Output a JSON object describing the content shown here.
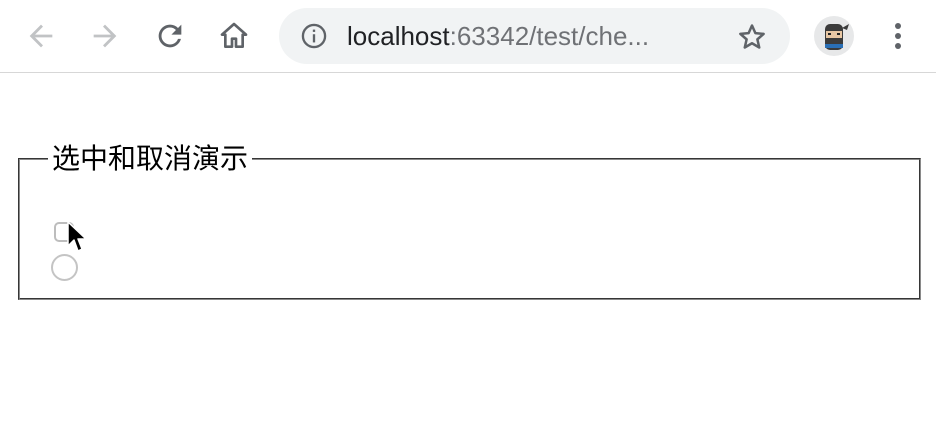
{
  "browser": {
    "back_icon": "arrow-left-icon",
    "forward_icon": "arrow-right-icon",
    "reload_icon": "reload-icon",
    "home_icon": "home-icon",
    "url_host": "localhost",
    "url_path": ":63342/test/che...",
    "info_icon": "info-icon",
    "bookmark_icon": "star-icon",
    "menu_icon": "vertical-dots-icon",
    "avatar_icon": "ninja-avatar-icon"
  },
  "page": {
    "legend": "选中和取消演示",
    "checkbox": {
      "checked": false
    },
    "radio": {
      "checked": false
    }
  },
  "colors": {
    "omnibox_bg": "#f1f3f4",
    "toolbar_icon": "#5f6368",
    "disabled_icon": "#c1c3c5",
    "fieldset_border": "#8a8a8a"
  }
}
